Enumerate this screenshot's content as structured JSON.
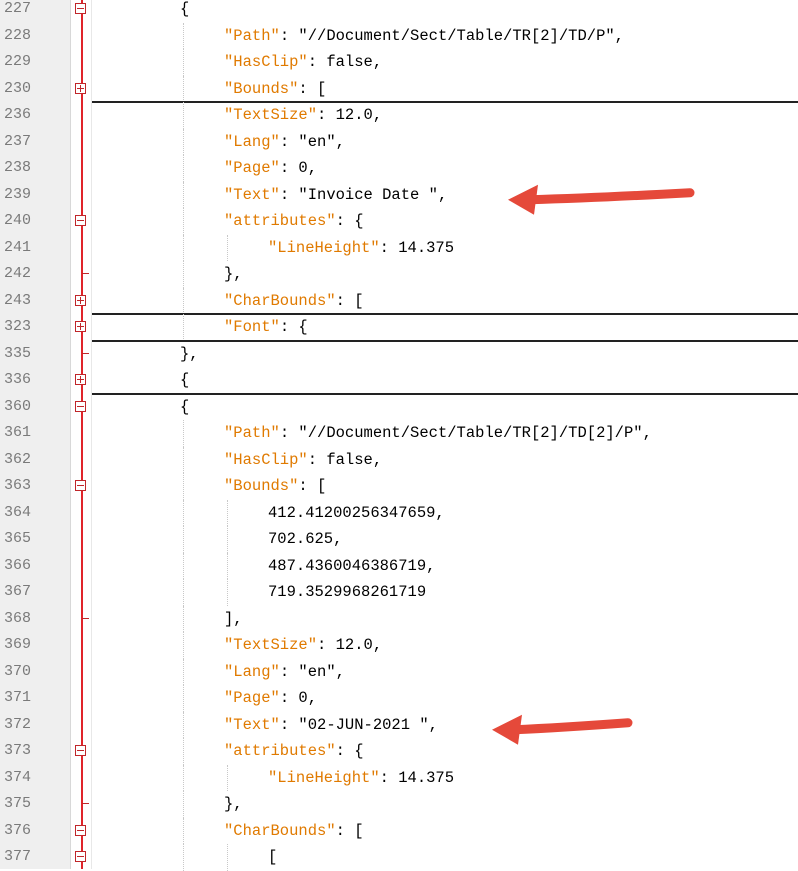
{
  "editor": {
    "lines": [
      {
        "num": "227",
        "indent": 0,
        "fold": "minus",
        "tokens": [
          {
            "t": "{",
            "c": "p"
          }
        ]
      },
      {
        "num": "228",
        "indent": 1,
        "fold": "",
        "tokens": [
          {
            "t": "\"Path\"",
            "c": "k"
          },
          {
            "t": ": \"//Document/Sect/Table/TR[2]/TD/P\",",
            "c": "p"
          }
        ]
      },
      {
        "num": "229",
        "indent": 1,
        "fold": "",
        "tokens": [
          {
            "t": "\"HasClip\"",
            "c": "k"
          },
          {
            "t": ": false,",
            "c": "p"
          }
        ]
      },
      {
        "num": "230",
        "indent": 1,
        "fold": "plus",
        "collapsed": true,
        "tokens": [
          {
            "t": "\"Bounds\"",
            "c": "k"
          },
          {
            "t": ": [",
            "c": "p"
          }
        ]
      },
      {
        "num": "236",
        "indent": 1,
        "fold": "",
        "tokens": [
          {
            "t": "\"TextSize\"",
            "c": "k"
          },
          {
            "t": ": 12.0,",
            "c": "p"
          }
        ]
      },
      {
        "num": "237",
        "indent": 1,
        "fold": "",
        "tokens": [
          {
            "t": "\"Lang\"",
            "c": "k"
          },
          {
            "t": ": \"en\",",
            "c": "p"
          }
        ]
      },
      {
        "num": "238",
        "indent": 1,
        "fold": "",
        "tokens": [
          {
            "t": "\"Page\"",
            "c": "k"
          },
          {
            "t": ": 0,",
            "c": "p"
          }
        ]
      },
      {
        "num": "239",
        "indent": 1,
        "fold": "",
        "tokens": [
          {
            "t": "\"Text\"",
            "c": "k"
          },
          {
            "t": ": \"Invoice Date \",",
            "c": "p"
          }
        ]
      },
      {
        "num": "240",
        "indent": 1,
        "fold": "minus",
        "tokens": [
          {
            "t": "\"attributes\"",
            "c": "k"
          },
          {
            "t": ": {",
            "c": "p"
          }
        ]
      },
      {
        "num": "241",
        "indent": 2,
        "fold": "",
        "tokens": [
          {
            "t": "\"LineHeight\"",
            "c": "k"
          },
          {
            "t": ": 14.375",
            "c": "p"
          }
        ]
      },
      {
        "num": "242",
        "indent": 1,
        "fold": "end",
        "tokens": [
          {
            "t": "},",
            "c": "p"
          }
        ]
      },
      {
        "num": "243",
        "indent": 1,
        "fold": "plus",
        "collapsed": true,
        "tokens": [
          {
            "t": "\"CharBounds\"",
            "c": "k"
          },
          {
            "t": ": [",
            "c": "p"
          }
        ]
      },
      {
        "num": "323",
        "indent": 1,
        "fold": "plus",
        "collapsed": true,
        "tokens": [
          {
            "t": "\"Font\"",
            "c": "k"
          },
          {
            "t": ": {",
            "c": "p"
          }
        ]
      },
      {
        "num": "335",
        "indent": 0,
        "fold": "end",
        "tokens": [
          {
            "t": "},",
            "c": "p"
          }
        ]
      },
      {
        "num": "336",
        "indent": 0,
        "fold": "plus",
        "collapsed": true,
        "tokens": [
          {
            "t": "{",
            "c": "p"
          }
        ]
      },
      {
        "num": "360",
        "indent": 0,
        "fold": "minus",
        "tokens": [
          {
            "t": "{",
            "c": "p"
          }
        ]
      },
      {
        "num": "361",
        "indent": 1,
        "fold": "",
        "tokens": [
          {
            "t": "\"Path\"",
            "c": "k"
          },
          {
            "t": ": \"//Document/Sect/Table/TR[2]/TD[2]/P\",",
            "c": "p"
          }
        ]
      },
      {
        "num": "362",
        "indent": 1,
        "fold": "",
        "tokens": [
          {
            "t": "\"HasClip\"",
            "c": "k"
          },
          {
            "t": ": false,",
            "c": "p"
          }
        ]
      },
      {
        "num": "363",
        "indent": 1,
        "fold": "minus",
        "tokens": [
          {
            "t": "\"Bounds\"",
            "c": "k"
          },
          {
            "t": ": [",
            "c": "p"
          }
        ]
      },
      {
        "num": "364",
        "indent": 2,
        "fold": "",
        "tokens": [
          {
            "t": "412.41200256347659,",
            "c": "p"
          }
        ]
      },
      {
        "num": "365",
        "indent": 2,
        "fold": "",
        "tokens": [
          {
            "t": "702.625,",
            "c": "p"
          }
        ]
      },
      {
        "num": "366",
        "indent": 2,
        "fold": "",
        "tokens": [
          {
            "t": "487.4360046386719,",
            "c": "p"
          }
        ]
      },
      {
        "num": "367",
        "indent": 2,
        "fold": "",
        "tokens": [
          {
            "t": "719.3529968261719",
            "c": "p"
          }
        ]
      },
      {
        "num": "368",
        "indent": 1,
        "fold": "end",
        "tokens": [
          {
            "t": "],",
            "c": "p"
          }
        ]
      },
      {
        "num": "369",
        "indent": 1,
        "fold": "",
        "tokens": [
          {
            "t": "\"TextSize\"",
            "c": "k"
          },
          {
            "t": ": 12.0,",
            "c": "p"
          }
        ]
      },
      {
        "num": "370",
        "indent": 1,
        "fold": "",
        "tokens": [
          {
            "t": "\"Lang\"",
            "c": "k"
          },
          {
            "t": ": \"en\",",
            "c": "p"
          }
        ]
      },
      {
        "num": "371",
        "indent": 1,
        "fold": "",
        "tokens": [
          {
            "t": "\"Page\"",
            "c": "k"
          },
          {
            "t": ": 0,",
            "c": "p"
          }
        ]
      },
      {
        "num": "372",
        "indent": 1,
        "fold": "",
        "tokens": [
          {
            "t": "\"Text\"",
            "c": "k"
          },
          {
            "t": ": \"02-JUN-2021 \",",
            "c": "p"
          }
        ]
      },
      {
        "num": "373",
        "indent": 1,
        "fold": "minus",
        "tokens": [
          {
            "t": "\"attributes\"",
            "c": "k"
          },
          {
            "t": ": {",
            "c": "p"
          }
        ]
      },
      {
        "num": "374",
        "indent": 2,
        "fold": "",
        "tokens": [
          {
            "t": "\"LineHeight\"",
            "c": "k"
          },
          {
            "t": ": 14.375",
            "c": "p"
          }
        ]
      },
      {
        "num": "375",
        "indent": 1,
        "fold": "end",
        "tokens": [
          {
            "t": "},",
            "c": "p"
          }
        ]
      },
      {
        "num": "376",
        "indent": 1,
        "fold": "minus",
        "tokens": [
          {
            "t": "\"CharBounds\"",
            "c": "k"
          },
          {
            "t": ": [",
            "c": "p"
          }
        ]
      },
      {
        "num": "377",
        "indent": 2,
        "fold": "minus",
        "tokens": [
          {
            "t": "[",
            "c": "p"
          }
        ]
      }
    ],
    "annotations": [
      {
        "name": "arrow-invoice-date",
        "line": "239"
      },
      {
        "name": "arrow-date-value",
        "line": "372"
      }
    ],
    "colors": {
      "key": "#e07a00",
      "line_number": "#7a7a7a",
      "fold_marker": "#c0262a",
      "arrow": "#e5493a"
    }
  }
}
